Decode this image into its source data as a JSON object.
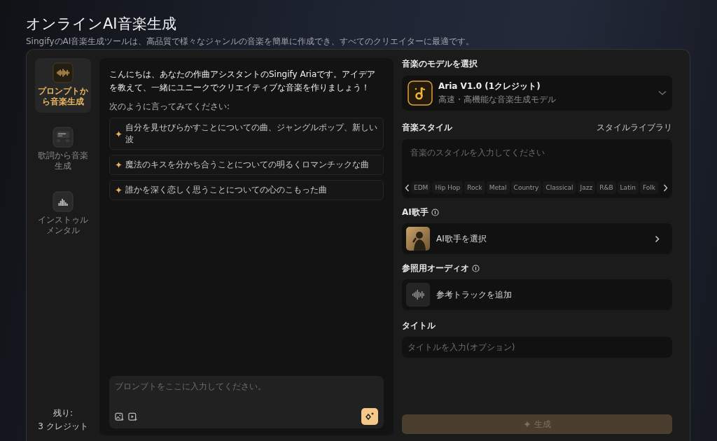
{
  "header": {
    "title": "オンラインAI音楽生成",
    "subtitle": "SingifyのAI音楽生成ツールは、高品質で様々なジャンルの音楽を簡単に作成でき、すべてのクリエイターに最適です。"
  },
  "modes": [
    {
      "label": "プロンプトから音楽生成",
      "selected": true,
      "kind": "prompt"
    },
    {
      "label": "歌詞から音楽生成",
      "selected": false,
      "kind": "lyrics"
    },
    {
      "label": "インストゥルメンタル",
      "selected": false,
      "kind": "instrumental"
    }
  ],
  "credits": {
    "label": "残り:",
    "amount": "3 クレジット"
  },
  "chat": {
    "greeting": "こんにちは、あなたの作曲アシスタントのSingify Ariaです。アイデアを教えて、一緒にユニークでクリエイティブな音楽を作りましょう！",
    "intro": "次のように言ってみてください:",
    "suggestions": [
      "自分を見せびらかすことについての曲、ジャングルポップ、新しい波",
      "魔法のキスを分かち合うことについての明るくロマンチックな曲",
      "誰かを深く恋しく思うことについての心のこもった曲"
    ],
    "prompt": {
      "placeholder": "プロンプトをここに入力してください。"
    }
  },
  "model": {
    "label": "音楽のモデルを選択",
    "name": "Aria V1.0 (1クレジット)",
    "description": "高速・高機能な音楽生成モデル"
  },
  "style": {
    "label": "音楽スタイル",
    "library_link": "スタイルライブラリ",
    "placeholder": "音楽のスタイルを入力してください",
    "genres": [
      "EDM",
      "Hip Hop",
      "Rock",
      "Metal",
      "Country",
      "Classical",
      "Jazz",
      "R&B",
      "Latin",
      "Folk"
    ]
  },
  "singer": {
    "label": "AI歌手",
    "select": "AI歌手を選択"
  },
  "reference_audio": {
    "label": "参照用オーディオ",
    "add": "参考トラックを追加"
  },
  "title": {
    "label": "タイトル",
    "placeholder": "タイトルを入力(オプション)"
  },
  "generate": {
    "label": "生成",
    "disabled": true
  }
}
